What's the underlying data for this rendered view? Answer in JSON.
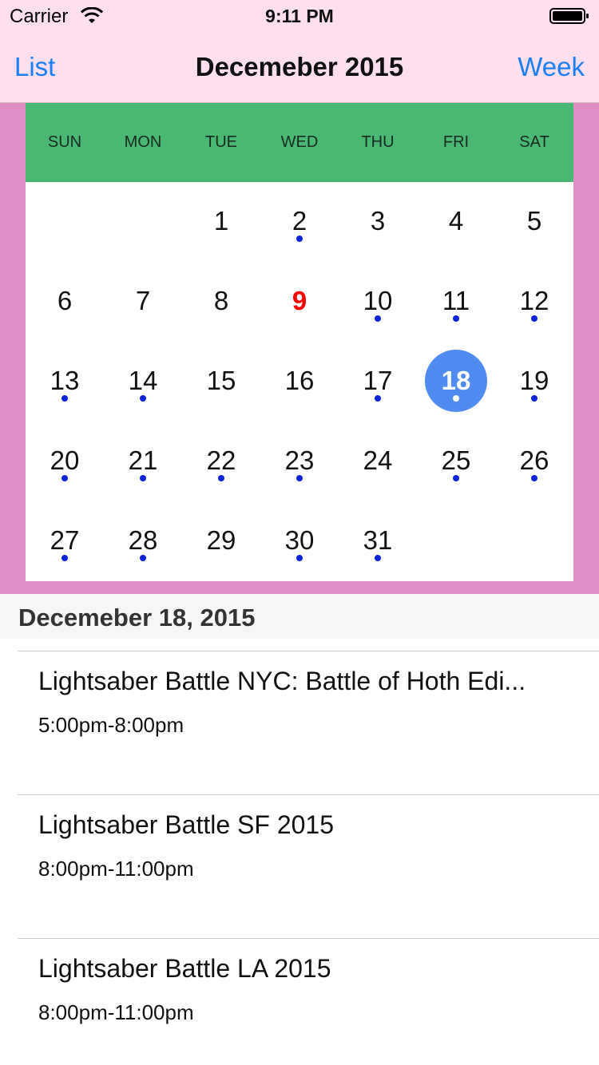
{
  "status_bar": {
    "carrier": "Carrier",
    "time": "9:11 PM"
  },
  "nav": {
    "left": "List",
    "title": "Decemeber 2015",
    "right": "Week"
  },
  "calendar": {
    "weekdays": [
      "SUN",
      "MON",
      "TUE",
      "WED",
      "THU",
      "FRI",
      "SAT"
    ],
    "weeks": [
      [
        null,
        null,
        {
          "d": "1"
        },
        {
          "d": "2",
          "dot": true
        },
        {
          "d": "3"
        },
        {
          "d": "4"
        },
        {
          "d": "5"
        }
      ],
      [
        {
          "d": "6"
        },
        {
          "d": "7"
        },
        {
          "d": "8"
        },
        {
          "d": "9",
          "today": true
        },
        {
          "d": "10",
          "dot": true
        },
        {
          "d": "11",
          "dot": true
        },
        {
          "d": "12",
          "dot": true
        }
      ],
      [
        {
          "d": "13",
          "dot": true
        },
        {
          "d": "14",
          "dot": true
        },
        {
          "d": "15"
        },
        {
          "d": "16"
        },
        {
          "d": "17",
          "dot": true
        },
        {
          "d": "18",
          "dot": true,
          "selected": true
        },
        {
          "d": "19",
          "dot": true
        }
      ],
      [
        {
          "d": "20",
          "dot": true
        },
        {
          "d": "21",
          "dot": true
        },
        {
          "d": "22",
          "dot": true
        },
        {
          "d": "23",
          "dot": true
        },
        {
          "d": "24"
        },
        {
          "d": "25",
          "dot": true
        },
        {
          "d": "26",
          "dot": true
        }
      ],
      [
        {
          "d": "27",
          "dot": true
        },
        {
          "d": "28",
          "dot": true
        },
        {
          "d": "29"
        },
        {
          "d": "30",
          "dot": true
        },
        {
          "d": "31",
          "dot": true
        },
        null,
        null
      ]
    ]
  },
  "section": {
    "title": "Decemeber 18, 2015"
  },
  "events": [
    {
      "title": "Lightsaber Battle NYC: Battle of Hoth Edi...",
      "time": "5:00pm-8:00pm"
    },
    {
      "title": "Lightsaber Battle SF 2015",
      "time": "8:00pm-11:00pm"
    },
    {
      "title": "Lightsaber Battle LA 2015",
      "time": "8:00pm-11:00pm"
    }
  ],
  "colors": {
    "nav_bg": "#fedff0",
    "calendar_frame": "#de8ec2",
    "weekday_header": "#49b872",
    "accent_blue": "#1a7ff5",
    "selected_day": "#4f8bf0",
    "today": "#ff0000",
    "event_dot": "#0a23e0"
  },
  "icons": {
    "wifi": "wifi-icon",
    "battery": "battery-icon"
  }
}
